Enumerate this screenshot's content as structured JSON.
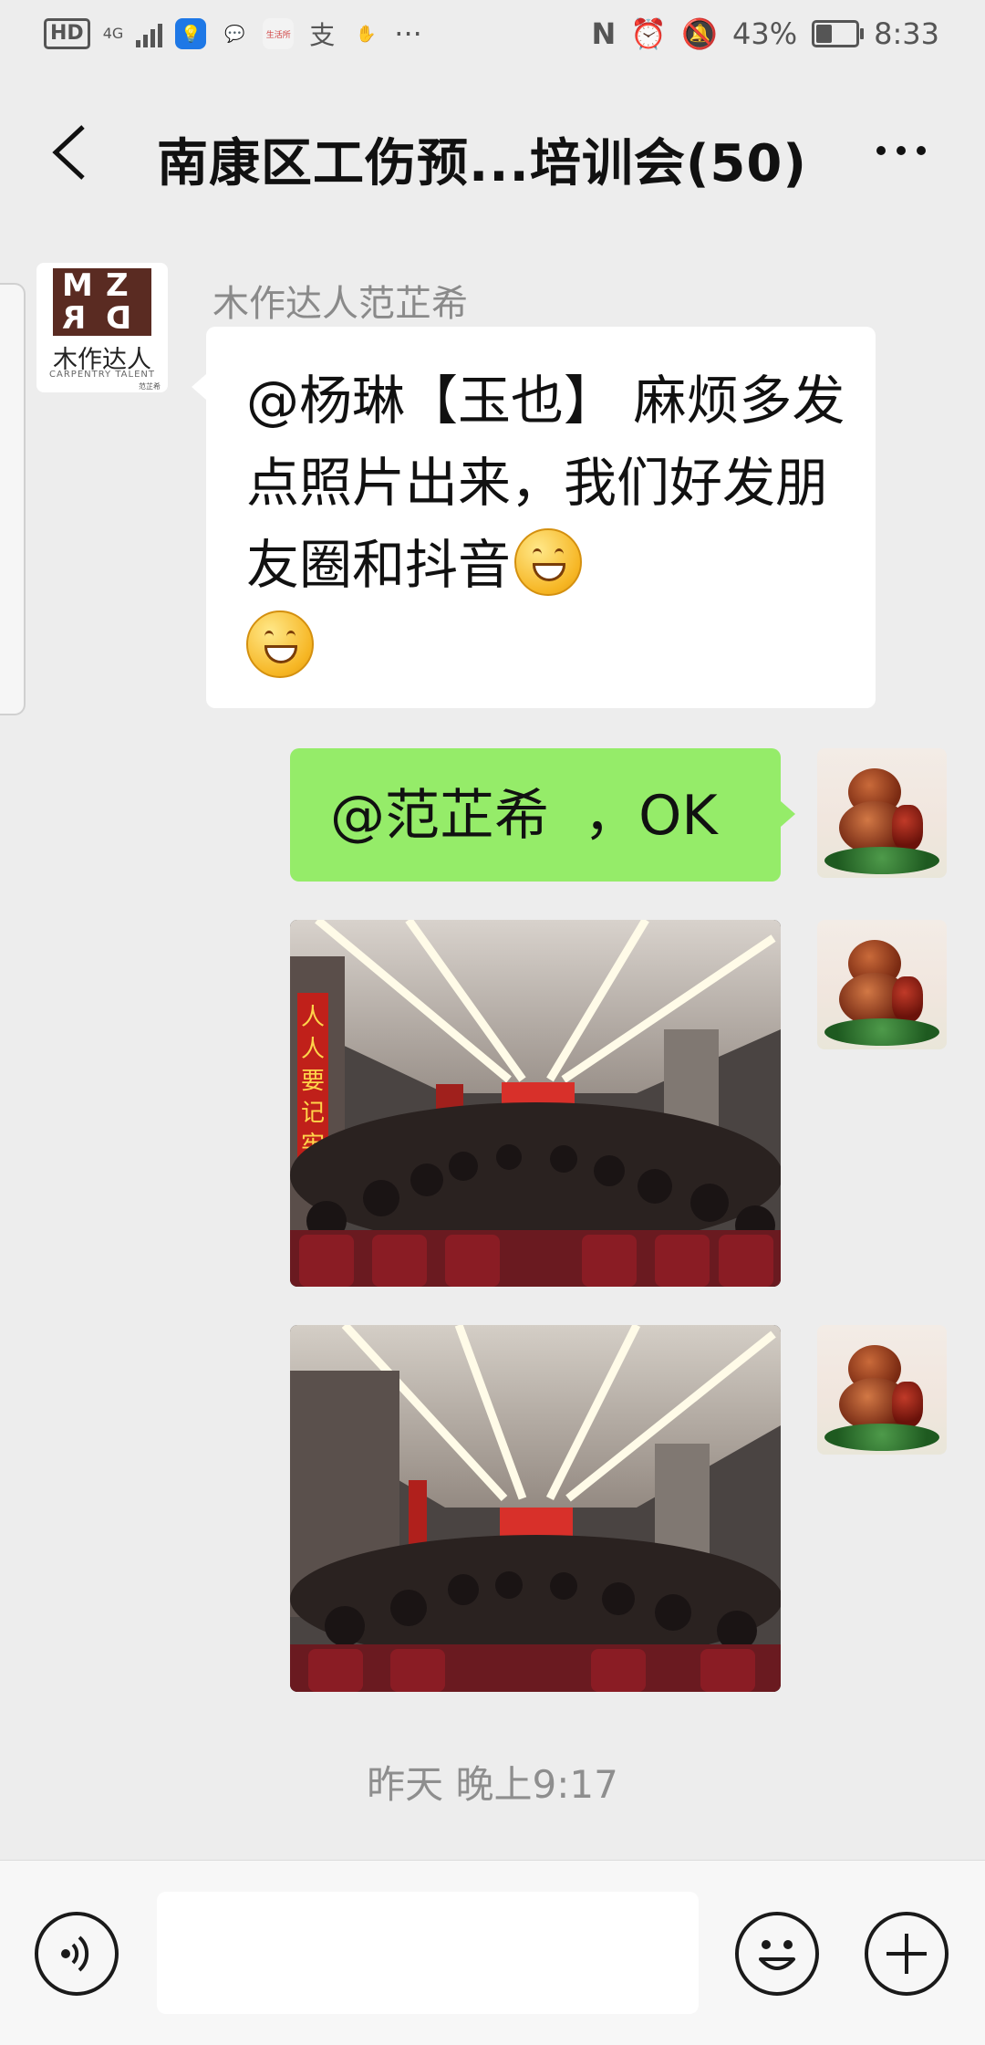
{
  "status_bar": {
    "hd": "HD",
    "network": "4G",
    "battery": "43%",
    "battery_level": 0.43,
    "time": "8:33",
    "more": "···",
    "app_icon_text": "生活所"
  },
  "header": {
    "title": "南康区工伤预...培训会(50)"
  },
  "messages": [
    {
      "sender": "木作达人范芷希",
      "text": "@杨琳【玉也】 麻烦多发点照片出来，我们好发朋友圈和抖音",
      "emoji": "grinning-face"
    },
    {
      "text": "@范芷希  ，OK"
    }
  ],
  "logo": {
    "letters": "MZ RD",
    "cn": "木作达人",
    "en": "CARPENTRY TALENT",
    "small": "范芷希"
  },
  "photo_banner_text": "人人要记牢",
  "timestamp": "昨天 晚上9:17",
  "input": {
    "placeholder": ""
  },
  "colors": {
    "background": "#ededed",
    "own_bubble": "#95ec69",
    "other_bubble": "#ffffff",
    "timestamp": "#8e8e8e"
  }
}
